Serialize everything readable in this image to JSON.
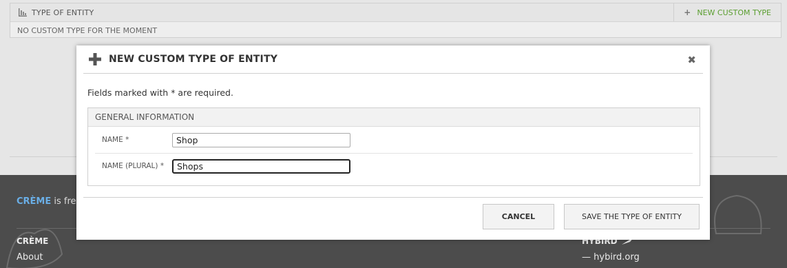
{
  "entity_block": {
    "title": "TYPE OF ENTITY",
    "new_button": "NEW CUSTOM TYPE",
    "empty_text": "NO CUSTOM TYPE FOR THE MOMENT",
    "icons": {
      "header": "bar-chart-icon",
      "new": "plus-icon"
    },
    "accent_color": "#5a9e2f"
  },
  "footer": {
    "brand": "CRÈME",
    "licence_text": " is free/",
    "creme_title": "CRÈME",
    "creme_about": "About",
    "hybird_title": "HYBIRD",
    "hybird_link": "— hybird.org",
    "brand_color": "#6aaee6"
  },
  "modal": {
    "title": "NEW CUSTOM TYPE OF ENTITY",
    "close_icon": "close-icon",
    "required_note": "Fields marked with * are required.",
    "fieldset_legend": "GENERAL INFORMATION",
    "fields": [
      {
        "label": "NAME *",
        "value": "Shop"
      },
      {
        "label": "NAME (PLURAL) *",
        "value": "Shops"
      }
    ],
    "cancel_label": "CANCEL",
    "save_label": "SAVE THE TYPE OF ENTITY"
  }
}
